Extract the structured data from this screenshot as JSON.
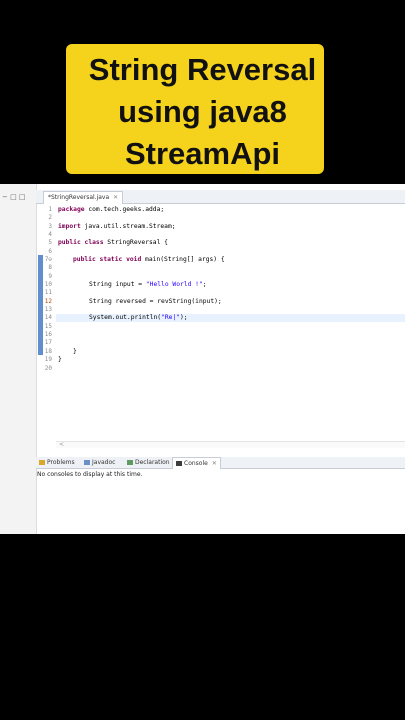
{
  "banner": {
    "line1": "String Reversal",
    "line2": "using java8",
    "line3": "StreamApi"
  },
  "ide": {
    "view_controls": "− □ □",
    "editor_tab": {
      "label": "*StringReversal.java",
      "close": "✕"
    },
    "line_numbers": [
      "1",
      "2",
      "3",
      "4",
      "5",
      "6",
      "7⊖",
      "8",
      "9",
      "10",
      "11",
      "12",
      "13",
      "14",
      "15",
      "16",
      "17",
      "18",
      "19",
      "20"
    ],
    "code": {
      "l1_kw": "package",
      "l1_rest": " com.tech.geeks.adda;",
      "l3_kw": "import",
      "l3_rest": " java.util.stream.Stream;",
      "l5_kw": "public class",
      "l5_rest": " StringReversal {",
      "l7_kw": "public static void",
      "l7_rest": " main(String[] args) {",
      "l10_a": "String input = ",
      "l10_str": "\"Hello World !\"",
      "l10_b": ";",
      "l12_a": "String reversed = revString(input);",
      "l14_a": "System.out.println(",
      "l14_str": "\"Re|\"",
      "l14_b": ");",
      "l18": "}",
      "l19": "}"
    },
    "bottom_tabs": [
      {
        "label": "Problems",
        "color": "#d8a72b"
      },
      {
        "label": "Javadoc",
        "color": "#6b8fc7"
      },
      {
        "label": "Declaration",
        "color": "#5f9b5f"
      },
      {
        "label": "Console",
        "color": "#3d3d3d",
        "close": "✕"
      }
    ],
    "console_message": "No consoles to display at this time."
  }
}
